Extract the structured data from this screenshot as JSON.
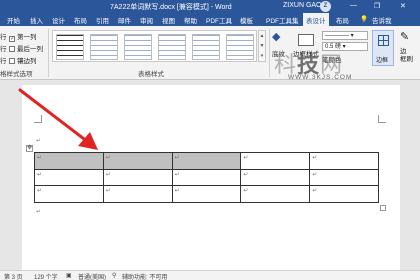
{
  "titlebar": {
    "doc_title": "7A222单词默写.docx [兼容模式] - Word",
    "user": "ZIXUN GAO",
    "avatar": "Z",
    "min": "—",
    "restore": "❐",
    "close": "✕"
  },
  "tabs": [
    "开始",
    "插入",
    "设计",
    "布局",
    "引用",
    "邮件",
    "审阅",
    "视图",
    "帮助",
    "PDF工具",
    "模板",
    "PDF工具集",
    "表设计",
    "布局",
    "告诉我"
  ],
  "ribbon": {
    "options": [
      {
        "label": "第一列",
        "checked": true
      },
      {
        "label": "最后一列",
        "checked": false
      },
      {
        "label": "镶边列",
        "checked": false
      }
    ],
    "left_partial": [
      "行",
      "行",
      "行"
    ],
    "options_group": "格样式选项",
    "styles_group": "表格样式",
    "shading": "底纹",
    "border_styles": "边框样式",
    "pen_weight": "0.5 磅",
    "pen_color": "笔颜色",
    "borders": "边框",
    "border_painter": "边\n框刷"
  },
  "document": {
    "paragraph_mark": "↵",
    "table": {
      "rows": 3,
      "cols": 5,
      "shaded_cells": [
        [
          0,
          0
        ],
        [
          0,
          1
        ],
        [
          0,
          2
        ]
      ]
    }
  },
  "statusbar": {
    "page": "第 3 页",
    "words": "129 个字",
    "lang": "普通(美国)",
    "accessibility": "辅助功能: 不可用"
  },
  "watermark": {
    "text_a": "科",
    "text_b": "技",
    "text_c": "网",
    "url": "WWW.3KJS.COM"
  },
  "colors": {
    "accent": "#2b579a",
    "arrow": "#e02424",
    "shade": "#c0c0c0"
  }
}
